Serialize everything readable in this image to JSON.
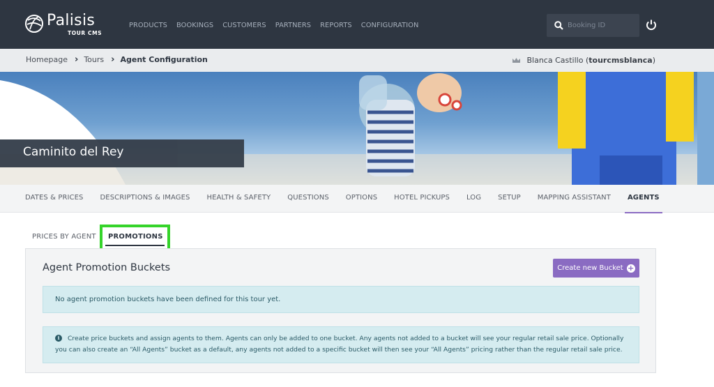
{
  "brand": {
    "name": "Palisis",
    "sub": "TOUR CMS"
  },
  "nav": [
    "PRODUCTS",
    "BOOKINGS",
    "CUSTOMERS",
    "PARTNERS",
    "REPORTS",
    "CONFIGURATION"
  ],
  "search": {
    "placeholder": "Booking ID",
    "icon": "search-icon"
  },
  "breadcrumb": {
    "items": [
      "Homepage",
      "Tours"
    ],
    "current": "Agent Configuration"
  },
  "user": {
    "name": "Blanca Castillo",
    "handle": "tourcmsblanca",
    "open": "(",
    "close": ")"
  },
  "hero": {
    "title": "Caminito del Rey"
  },
  "tabs": [
    {
      "label": "DATES & PRICES",
      "active": false
    },
    {
      "label": "DESCRIPTIONS & IMAGES",
      "active": false
    },
    {
      "label": "HEALTH & SAFETY",
      "active": false
    },
    {
      "label": "QUESTIONS",
      "active": false
    },
    {
      "label": "OPTIONS",
      "active": false
    },
    {
      "label": "HOTEL PICKUPS",
      "active": false
    },
    {
      "label": "LOG",
      "active": false
    },
    {
      "label": "SETUP",
      "active": false
    },
    {
      "label": "MAPPING ASSISTANT",
      "active": false
    },
    {
      "label": "AGENTS",
      "active": true
    }
  ],
  "subtabs": {
    "prices_by_agent": "PRICES BY AGENT",
    "promotions": "PROMOTIONS"
  },
  "panel": {
    "title": "Agent Promotion Buckets",
    "create_button": "Create new Bucket",
    "empty_message": "No agent promotion buckets have been defined for this tour yet.",
    "info_text": "Create price buckets and assign agents to them. Agents can only be added to one bucket. Any agents not added to a bucket will see your regular retail sale price. Optionally you can also create an “All Agents” bucket as a default, any agents not added to a specific bucket will then see your “All Agents” pricing rather than the regular retail sale price."
  },
  "colors": {
    "header": "#2e3641",
    "accent": "#8a6bc2",
    "highlight": "#35d42a",
    "info_bg": "#d5ecf0"
  }
}
